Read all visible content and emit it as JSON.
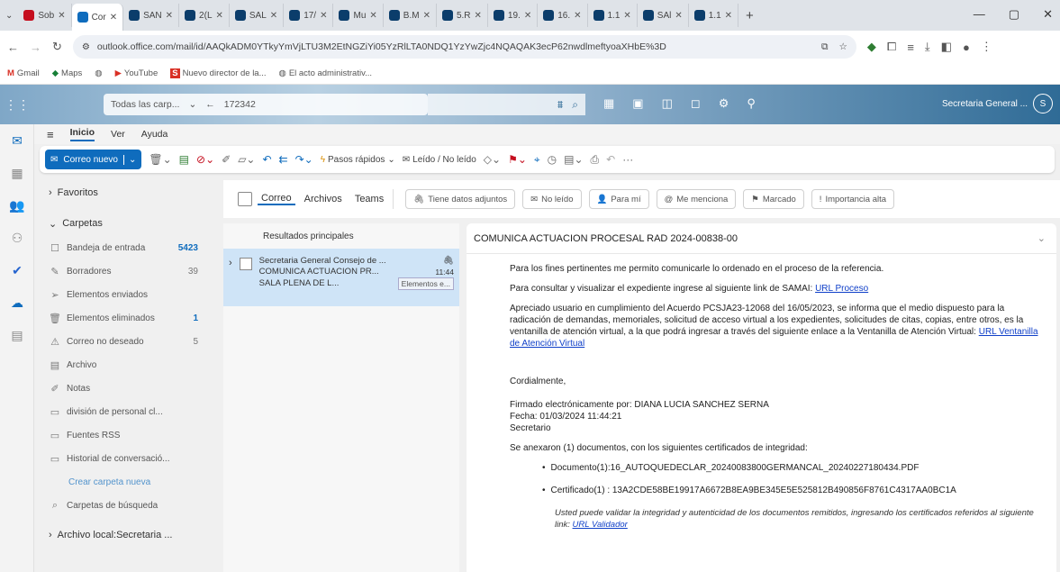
{
  "browser": {
    "tabs": [
      {
        "label": "Sob",
        "color": "#c50f1f"
      },
      {
        "label": "Cor",
        "color": "#0f6cbd",
        "active": true
      },
      {
        "label": "SAN",
        "color": "#0b3d6b"
      },
      {
        "label": "2(L",
        "color": "#0b3d6b"
      },
      {
        "label": "SAL",
        "color": "#0b3d6b"
      },
      {
        "label": "17/",
        "color": "#0b3d6b"
      },
      {
        "label": "Mu",
        "color": "#0b3d6b"
      },
      {
        "label": "B.M",
        "color": "#0b3d6b"
      },
      {
        "label": "5.R",
        "color": "#0b3d6b"
      },
      {
        "label": "19.",
        "color": "#0b3d6b"
      },
      {
        "label": "16.",
        "color": "#0b3d6b"
      },
      {
        "label": "1.1",
        "color": "#0b3d6b"
      },
      {
        "label": "SAl",
        "color": "#0b3d6b"
      },
      {
        "label": "1.1",
        "color": "#0b3d6b"
      }
    ],
    "url": "outlook.office.com/mail/id/AAQkADM0YTkyYmVjLTU3M2EtNGZiYi05YzRlLTA0NDQ1YzYwZjc4NQAQAK3ecP62nwdlmeftyoaXHbE%3D",
    "bookmarks": [
      "Gmail",
      "Maps",
      "YouTube",
      "Nuevo director de la...",
      "El acto administrativ..."
    ]
  },
  "outlook": {
    "search_scope": "Todas las carp...",
    "search_value": "172342",
    "user_name": "Secretaria General ...",
    "avatar_initials": "S"
  },
  "menu_tabs": [
    "Inicio",
    "Ver",
    "Ayuda"
  ],
  "ribbon": {
    "new_mail": "Correo nuevo",
    "quick_steps": "Pasos rápidos",
    "read_unread": "Leído / No leído"
  },
  "folders": {
    "favorites": "Favoritos",
    "section": "Carpetas",
    "items": [
      {
        "icon": "inbox-icon",
        "glyph": "☐",
        "label": "Bandeja de entrada",
        "count": "5423",
        "bold": true
      },
      {
        "icon": "drafts-icon",
        "glyph": "✎",
        "label": "Borradores",
        "count": "39",
        "bold": false
      },
      {
        "icon": "sent-icon",
        "glyph": "➢",
        "label": "Elementos enviados",
        "count": "",
        "bold": false
      },
      {
        "icon": "trash-icon",
        "glyph": "🗑",
        "label": "Elementos eliminados",
        "count": "1",
        "bold": true
      },
      {
        "icon": "junk-icon",
        "glyph": "⚠",
        "label": "Correo no deseado",
        "count": "5",
        "bold": false
      },
      {
        "icon": "archive-icon",
        "glyph": "▤",
        "label": "Archivo",
        "count": "",
        "bold": false
      },
      {
        "icon": "notes-icon",
        "glyph": "✐",
        "label": "Notas",
        "count": "",
        "bold": false
      },
      {
        "icon": "folder-icon",
        "glyph": "▭",
        "label": "división de personal cl...",
        "count": "",
        "bold": false
      },
      {
        "icon": "rss-icon",
        "glyph": "▭",
        "label": "Fuentes RSS",
        "count": "",
        "bold": false
      },
      {
        "icon": "folder-icon",
        "glyph": "▭",
        "label": "Historial de conversació...",
        "count": "",
        "bold": false
      }
    ],
    "new_folder": "Crear carpeta nueva",
    "search_folders": "Carpetas de búsqueda",
    "local_archive": "Archivo local:Secretaria ..."
  },
  "filters": {
    "tabs": [
      "Correo",
      "Archivos",
      "Teams"
    ],
    "buttons": [
      {
        "icon": "attachment-icon",
        "glyph": "🖇",
        "label": "Tiene datos adjuntos"
      },
      {
        "icon": "unread-icon",
        "glyph": "✉",
        "label": "No leído"
      },
      {
        "icon": "to-me-icon",
        "glyph": "👤",
        "label": "Para mí"
      },
      {
        "icon": "mention-icon",
        "glyph": "@",
        "label": "Me menciona"
      },
      {
        "icon": "flag-icon",
        "glyph": "⚑",
        "label": "Marcado"
      },
      {
        "icon": "important-icon",
        "glyph": "!",
        "label": "Importancia alta"
      }
    ]
  },
  "message_list": {
    "header": "Resultados principales",
    "message": {
      "sender": "Secretaria General Consejo de ...",
      "subject": "COMUNICA ACTUACION PR...",
      "time": "11:44",
      "preview": "SALA PLENA DE L...",
      "folder_chip": "Elementos e..."
    }
  },
  "reading": {
    "subject": "COMUNICA ACTUACION PROCESAL RAD 2024-00838-00",
    "p1": "Para los fines pertinentes me permito comunicarle lo ordenado en el proceso de la referencia.",
    "p2_text": "Para consultar y visualizar el expediente ingrese al siguiente link de SAMAI: ",
    "p2_link": "URL Proceso",
    "p3_text": "Apreciado usuario en cumplimiento del Acuerdo PCSJA23-12068 del 16/05/2023, se informa que el medio dispuesto para la radicación de demandas, memoriales, solicitud de acceso virtual a los expedientes, solicitudes de citas, copias, entre otros, es la ventanilla de atención virtual, a la que podrá ingresar a través del siguiente enlace a la Ventanilla de Atención Virtual: ",
    "p3_link": "URL Ventanilla de Atención Virtual",
    "closing": "Cordialmente,",
    "signed": "Firmado electrónicamente por: DIANA LUCIA SANCHEZ SERNA",
    "date": "Fecha: 01/03/2024 11:44:21",
    "role": "Secretario",
    "annex": "Se anexaron (1) documentos, con los siguientes certificados de integridad:",
    "doc": "Documento(1):16_AUTOQUEDECLAR_20240083800GERMANCAL_20240227180434.PDF",
    "cert": "Certificado(1) : 13A2CDE58BE19917A6672B8EA9BE345E5E525812B490856F8761C4317AA0BC1A",
    "validate_text": "Usted puede validar la integridad y autenticidad de los documentos remitidos, ingresando los certificados referidos al siguiente link: ",
    "validate_link": "URL Validador"
  }
}
